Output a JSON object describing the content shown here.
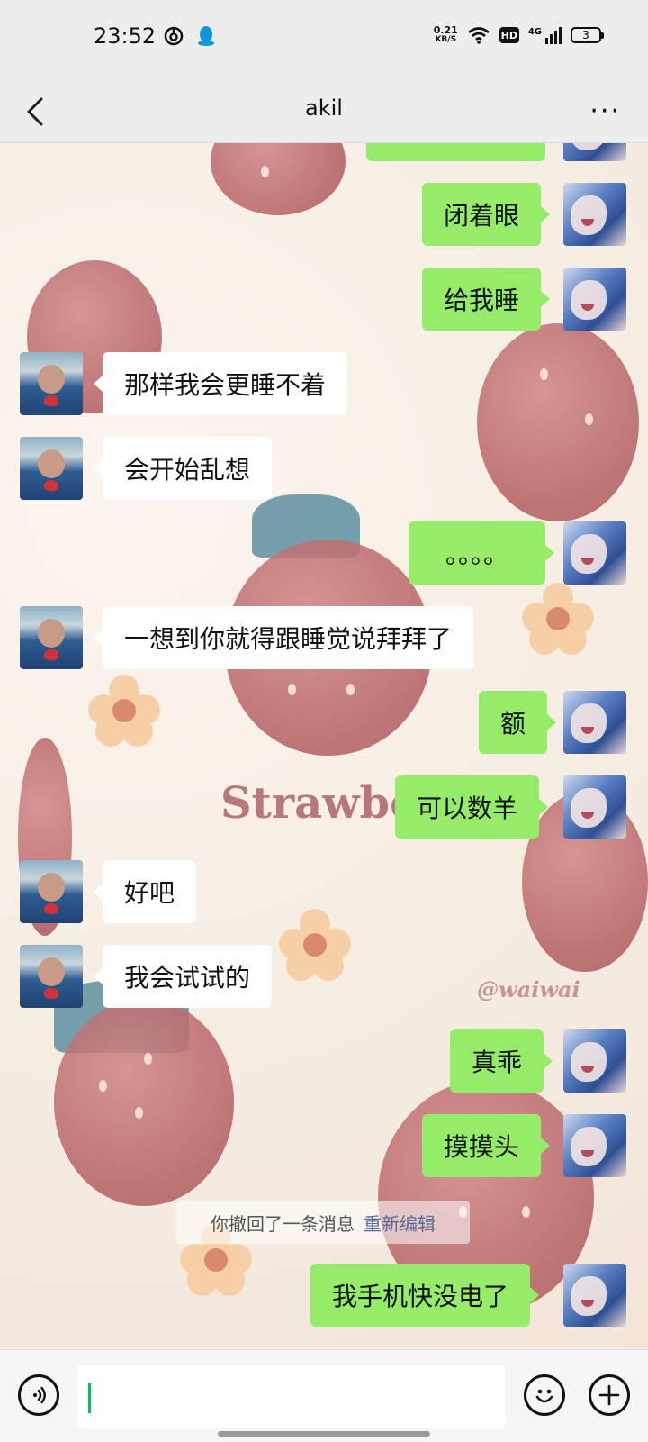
{
  "status_bar": {
    "time": "23:52",
    "net_speed_value": "0.21",
    "net_speed_unit": "KB/S",
    "hd_label": "HD",
    "network_label": "4G",
    "battery_level": "3",
    "icons": [
      "netease-music-icon",
      "qq-icon",
      "wifi-icon",
      "signal-icon"
    ]
  },
  "nav": {
    "title": "akil",
    "back_icon": "chevron-left-icon",
    "more_label": "···"
  },
  "wallpaper": {
    "text": "Strawberry",
    "watermark": "@waiwai"
  },
  "messages": [
    {
      "sender": "self",
      "text": "闭着眼"
    },
    {
      "sender": "self",
      "text": "给我睡"
    },
    {
      "sender": "friend",
      "text": "那样我会更睡不着"
    },
    {
      "sender": "friend",
      "text": "会开始乱想"
    },
    {
      "sender": "self",
      "text": "。。。。"
    },
    {
      "sender": "friend",
      "text": "一想到你就得跟睡觉说拜拜了"
    },
    {
      "sender": "self",
      "text": "额"
    },
    {
      "sender": "self",
      "text": "可以数羊"
    },
    {
      "sender": "friend",
      "text": "好吧"
    },
    {
      "sender": "friend",
      "text": "我会试试的"
    },
    {
      "sender": "self",
      "text": "真乖"
    },
    {
      "sender": "self",
      "text": "摸摸头"
    },
    {
      "sender": "self",
      "text": "我手机快没电了"
    }
  ],
  "system_message": {
    "text": "你撤回了一条消息",
    "action": "重新编辑"
  },
  "input_bar": {
    "voice_icon": "voice-icon",
    "emoji_icon": "emoji-icon",
    "plus_icon": "plus-icon",
    "value": ""
  },
  "colors": {
    "self_bubble": "#95ec69",
    "friend_bubble": "#ffffff",
    "bar_bg": "#ededed",
    "link": "#576b95"
  }
}
